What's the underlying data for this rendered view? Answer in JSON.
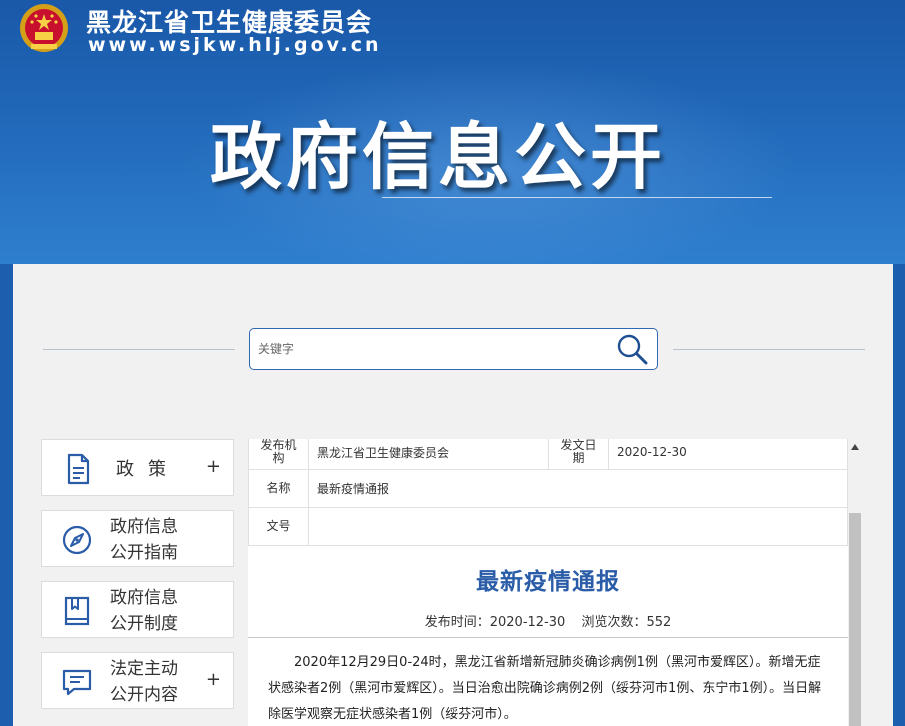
{
  "header": {
    "org_name": "黑龙江省卫生健康委员会",
    "org_url": "www.wsjkw.hlj.gov.cn",
    "banner_title": "政府信息公开",
    "emblem_icon": "national-emblem-icon"
  },
  "search": {
    "placeholder": "关键字",
    "button_icon": "search-icon"
  },
  "nav": {
    "items": [
      {
        "label": "政策",
        "plus": "+",
        "icon": "document-icon"
      },
      {
        "line1": "政府信息",
        "line2": "公开指南",
        "icon": "compass-icon"
      },
      {
        "line1": "政府信息",
        "line2": "公开制度",
        "icon": "book-icon"
      },
      {
        "line1": "法定主动",
        "line2": "公开内容",
        "plus": "+",
        "icon": "chat-icon"
      }
    ]
  },
  "document": {
    "meta": {
      "publisher_key": "发布机构",
      "publisher_value": "黑龙江省卫生健康委员会",
      "date_key": "发文日期",
      "date_value": "2020-12-30",
      "name_key": "名称",
      "name_value": "最新疫情通报",
      "number_key": "文号",
      "number_value": ""
    },
    "title": "最新疫情通报",
    "publish_label": "发布时间：2020-12-30",
    "views_label": "浏览次数：552",
    "body": "2020年12月29日0-24时，黑龙江省新增新冠肺炎确诊病例1例（黑河市爱辉区）。新增无症状感染者2例（黑河市爱辉区）。当日治愈出院确诊病例2例（绥芬河市1例、东宁市1例）。当日解除医学观察无症状感染者1例（绥芬河市）。"
  },
  "colors": {
    "header_blue": "#1d5fae",
    "title_blue": "#2a5ca8",
    "search_border": "#2f68b3"
  }
}
